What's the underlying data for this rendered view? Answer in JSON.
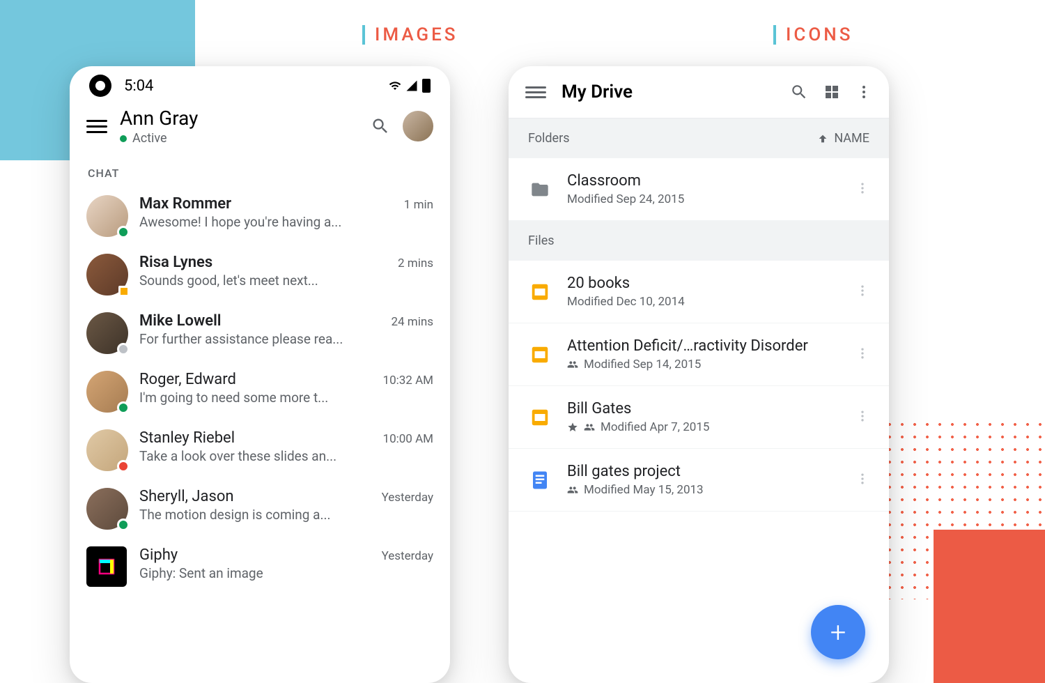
{
  "headings": {
    "images": "IMAGES",
    "icons": "ICONS"
  },
  "phone_left": {
    "status": {
      "time": "5:04"
    },
    "appbar": {
      "title": "Ann Gray",
      "subtitle": "Active"
    },
    "section_label": "CHAT",
    "chats": [
      {
        "name": "Max Rommer",
        "msg": "Awesome! I hope you're having a...",
        "time": "1 min",
        "bold": true,
        "badge": "green",
        "avatar_bg": "linear-gradient(135deg,#e8d5c4,#b89b7e)"
      },
      {
        "name": "Risa Lynes",
        "msg": "Sounds good, let's meet next...",
        "time": "2 mins",
        "bold": true,
        "badge": "orange",
        "avatar_bg": "linear-gradient(135deg,#8b5a3c,#5d3a28)"
      },
      {
        "name": "Mike Lowell",
        "msg": "For further assistance please rea...",
        "time": "24 mins",
        "bold": true,
        "badge": "gray",
        "avatar_bg": "linear-gradient(135deg,#6b5845,#3d3228)"
      },
      {
        "name": "Roger, Edward",
        "msg": "I'm going to need some more t...",
        "time": "10:32 AM",
        "bold": false,
        "badge": "green",
        "avatar_bg": "linear-gradient(135deg,#d4a574,#a67c52)"
      },
      {
        "name": "Stanley Riebel",
        "msg": "Take a look over these slides an...",
        "time": "10:00 AM",
        "bold": false,
        "badge": "red",
        "avatar_bg": "linear-gradient(135deg,#e0c9a6,#c4a67b)"
      },
      {
        "name": "Sheryll, Jason",
        "msg": "The motion design is coming  a...",
        "time": "Yesterday",
        "bold": false,
        "badge": "green",
        "avatar_bg": "linear-gradient(135deg,#8b6f5c,#5d4a3c)"
      },
      {
        "name": "Giphy",
        "msg": "Giphy: Sent an image",
        "time": "Yesterday",
        "bold": false,
        "badge": "",
        "avatar_bg": "",
        "square": true
      }
    ]
  },
  "phone_right": {
    "appbar": {
      "title": "My Drive"
    },
    "sections": {
      "folders": {
        "label": "Folders",
        "sort": "NAME"
      },
      "files": {
        "label": "Files"
      }
    },
    "folders": [
      {
        "name": "Classroom",
        "meta": "Modified Sep 24, 2015",
        "icon": "folder"
      }
    ],
    "files": [
      {
        "name": "20 books",
        "meta": "Modified Dec 10, 2014",
        "icon": "slides",
        "shared": false,
        "starred": false
      },
      {
        "name": "Attention Deficit/…ractivity Disorder",
        "meta": "Modified Sep 14, 2015",
        "icon": "slides",
        "shared": true,
        "starred": false
      },
      {
        "name": "Bill Gates",
        "meta": "Modified Apr 7, 2015",
        "icon": "slides",
        "shared": true,
        "starred": true
      },
      {
        "name": "Bill gates project",
        "meta": "Modified May 15, 2013",
        "icon": "docs",
        "shared": true,
        "starred": false
      }
    ]
  }
}
